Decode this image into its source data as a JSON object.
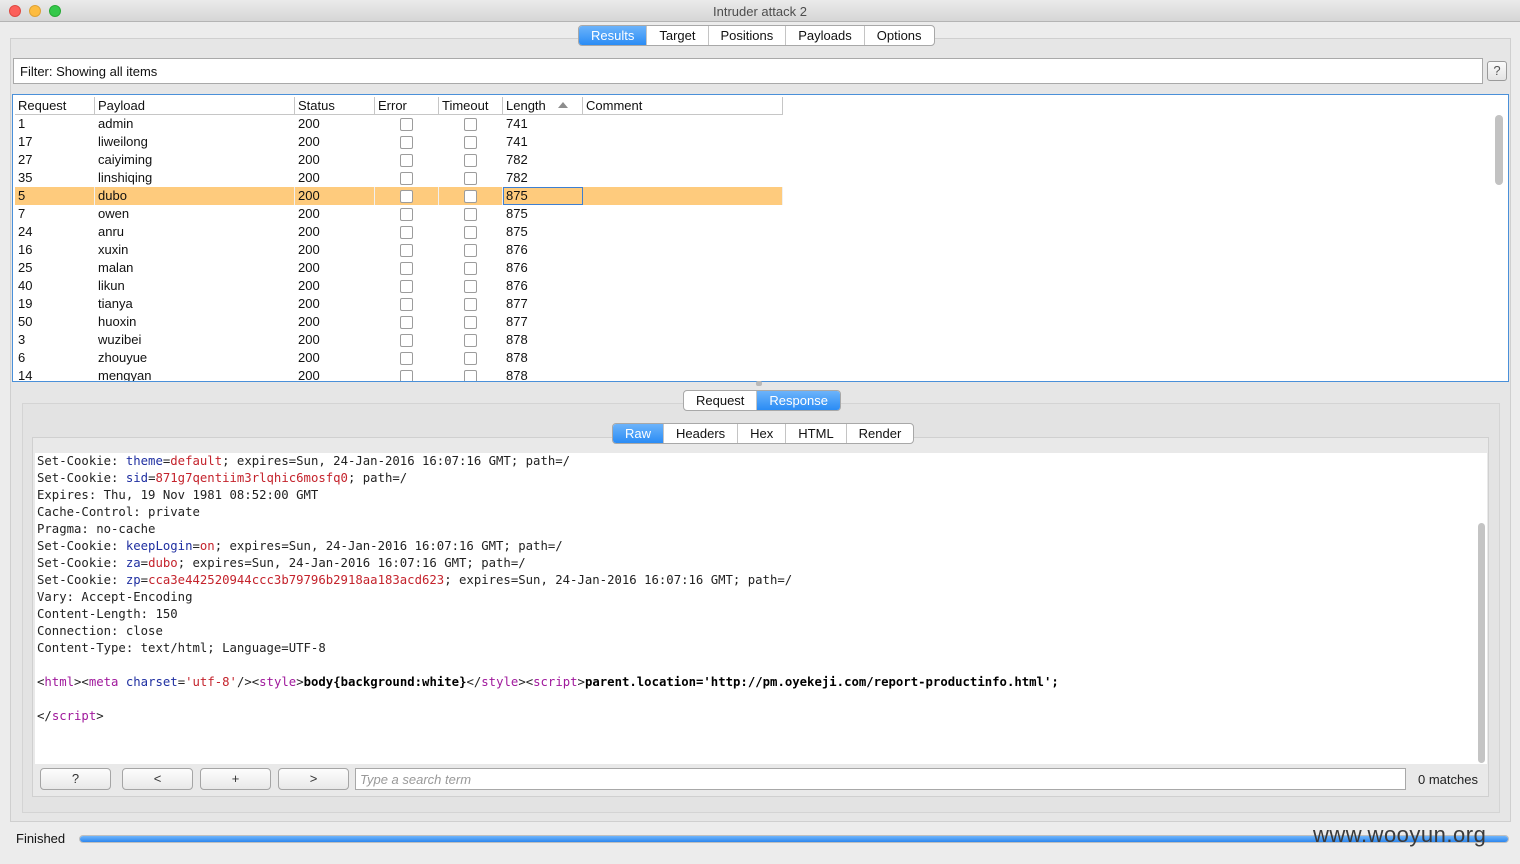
{
  "window": {
    "title": "Intruder attack 2"
  },
  "main_tabs": [
    "Results",
    "Target",
    "Positions",
    "Payloads",
    "Options"
  ],
  "main_active": 0,
  "filter": {
    "text": "Filter: Showing all items",
    "help": "?"
  },
  "table": {
    "columns": [
      "Request",
      "Payload",
      "Status",
      "Error",
      "Timeout",
      "Length",
      "Comment"
    ],
    "sorted_column": "Length",
    "selected_row": 4,
    "rows": [
      {
        "request": "1",
        "payload": "admin",
        "status": "200",
        "length": "741"
      },
      {
        "request": "17",
        "payload": "liweilong",
        "status": "200",
        "length": "741"
      },
      {
        "request": "27",
        "payload": "caiyiming",
        "status": "200",
        "length": "782"
      },
      {
        "request": "35",
        "payload": "linshiqing",
        "status": "200",
        "length": "782"
      },
      {
        "request": "5",
        "payload": "dubo",
        "status": "200",
        "length": "875"
      },
      {
        "request": "7",
        "payload": "owen",
        "status": "200",
        "length": "875"
      },
      {
        "request": "24",
        "payload": "anru",
        "status": "200",
        "length": "875"
      },
      {
        "request": "16",
        "payload": "xuxin",
        "status": "200",
        "length": "876"
      },
      {
        "request": "25",
        "payload": "malan",
        "status": "200",
        "length": "876"
      },
      {
        "request": "40",
        "payload": "likun",
        "status": "200",
        "length": "876"
      },
      {
        "request": "19",
        "payload": "tianya",
        "status": "200",
        "length": "877"
      },
      {
        "request": "50",
        "payload": "huoxin",
        "status": "200",
        "length": "877"
      },
      {
        "request": "3",
        "payload": "wuzibei",
        "status": "200",
        "length": "878"
      },
      {
        "request": "6",
        "payload": "zhouyue",
        "status": "200",
        "length": "878"
      },
      {
        "request": "14",
        "payload": "mengyan",
        "status": "200",
        "length": "878"
      }
    ]
  },
  "reqresp_tabs": [
    "Request",
    "Response"
  ],
  "reqresp_active": 1,
  "view_tabs": [
    "Raw",
    "Headers",
    "Hex",
    "HTML",
    "Render"
  ],
  "view_active": 0,
  "response": {
    "l1": [
      "Set-Cookie: ",
      "theme",
      "=",
      "default",
      "; expires=Sun, 24-Jan-2016 16:07:16 GMT; path=/"
    ],
    "l2": [
      "Set-Cookie: ",
      "sid",
      "=",
      "871g7qentiim3rlqhic6mosfq0",
      "; path=/"
    ],
    "l3": "Expires: Thu, 19 Nov 1981 08:52:00 GMT",
    "l4": "Cache-Control: private",
    "l5": "Pragma: no-cache",
    "l6": [
      "Set-Cookie: ",
      "keepLogin",
      "=",
      "on",
      "; expires=Sun, 24-Jan-2016 16:07:16 GMT; path=/"
    ],
    "l7": [
      "Set-Cookie: ",
      "za",
      "=",
      "dubo",
      "; expires=Sun, 24-Jan-2016 16:07:16 GMT; path=/"
    ],
    "l8": [
      "Set-Cookie: ",
      "zp",
      "=",
      "cca3e442520944ccc3b79796b2918aa183acd623",
      "; expires=Sun, 24-Jan-2016 16:07:16 GMT; path=/"
    ],
    "l9": "Vary: Accept-Encoding",
    "l10": "Content-Length: 150",
    "l11": "Connection: close",
    "l12": "Content-Type: text/html; Language=UTF-8",
    "html_line": {
      "p1": "<",
      "t1": "html",
      "p2": "><",
      "t2": "meta",
      "sp": " ",
      "a1": "charset",
      "eq": "=",
      "s1": "'utf-8'",
      "p3": "/><",
      "t3": "style",
      "p4": ">",
      "css": "body{background:white}",
      "p5": "</",
      "t4": "style",
      "p6": "><",
      "t5": "script",
      "p7": ">",
      "js": "parent.location='http://pm.oyekeji.com/report-productinfo.html';"
    },
    "close_line": {
      "p1": "</",
      "t1": "script",
      "p2": ">"
    }
  },
  "search": {
    "btn_help": "?",
    "btn_prev": "<",
    "btn_add": "+",
    "btn_next": ">",
    "placeholder": "Type a search term",
    "matches": "0 matches"
  },
  "status": {
    "text": "Finished",
    "progress": 1.0
  },
  "watermark": "www.wooyun.org"
}
